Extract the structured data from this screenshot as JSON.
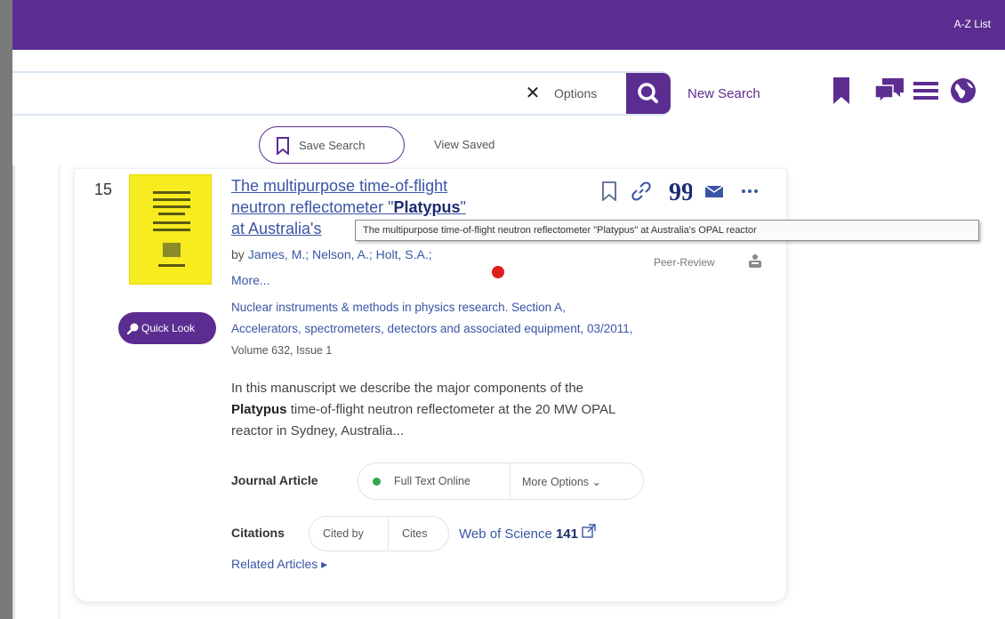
{
  "header": {
    "az_list": "A-Z List",
    "brand_color": "#5c2d91"
  },
  "search": {
    "options_label": "Options",
    "new_search": "New Search",
    "save_search": "Save Search",
    "view_saved": "View Saved",
    "icons": [
      "close-icon",
      "search-icon",
      "bookmark-icon",
      "chat-icon",
      "menu-icon",
      "globe-icon"
    ]
  },
  "result": {
    "number": "15",
    "title_line1": "The multipurpose time-of-flight",
    "title_line2_prefix": "neutron reflectometer \"",
    "title_highlight": "Platypus",
    "title_line2_suffix": "\"",
    "title_line3": "at Australia's",
    "tooltip": "The multipurpose time-of-flight neutron reflectometer \"Platypus\" at Australia's OPAL reactor",
    "authors_prefix": "by",
    "authors": "James, M.; Nelson, A.; Holt, S.A.;",
    "more": "More...",
    "peer_review": "Peer-Review",
    "journal_line1": "Nuclear instruments & methods in physics research. Section A,",
    "journal_line2": "Accelerators, spectrometers, detectors and associated equipment, 03/2011,",
    "journal_line3": "Volume 632, Issue 1",
    "abstract_line1": "In this manuscript we describe the major components of the",
    "abstract_highlight": "Platypus",
    "abstract_line2_rest": " time-of-flight neutron reflectometer at the 20 MW OPAL",
    "abstract_line3": "reactor in Sydney, Australia...",
    "quick_look": "Quick Look",
    "type": "Journal Article",
    "full_text": "Full Text Online",
    "more_options": "More Options",
    "citations_label": "Citations",
    "cited_by": "Cited by",
    "cites": "Cites",
    "wos_label": "Web of Science",
    "wos_count": "141",
    "related": "Related Articles",
    "actions": [
      "bookmark-icon",
      "link-icon",
      "quote-icon",
      "email-icon",
      "more-icon"
    ]
  }
}
